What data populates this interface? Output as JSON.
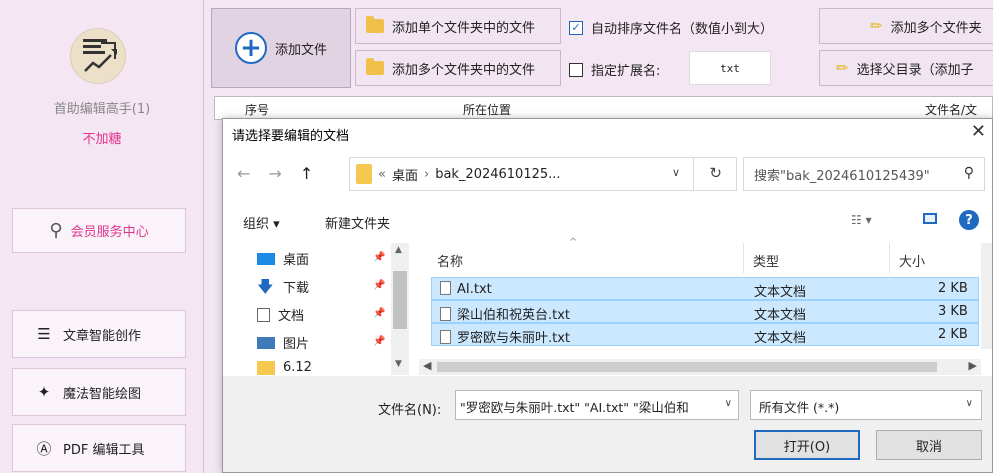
{
  "sidebar": {
    "user_name": "首助编辑高手(1)",
    "user_status": "不加糖",
    "member_center": "会员服务中心",
    "nav": [
      {
        "label": "文章智能创作",
        "icon": "menu-lines-icon"
      },
      {
        "label": "魔法智能绘图",
        "icon": "magic-wand-icon"
      },
      {
        "label": "PDF 编辑工具",
        "icon": "pdf-icon"
      }
    ]
  },
  "toolbar": {
    "add_file": "添加文件",
    "add_single_folder": "添加单个文件夹中的文件",
    "add_multi_folder": "添加多个文件夹中的文件",
    "auto_sort": "自动排序文件名（数值小到大）",
    "auto_sort_checked": true,
    "specify_ext": "指定扩展名:",
    "specify_ext_checked": false,
    "ext_value": "txt",
    "add_multi_files": "添加多个文件夹",
    "choose_parent": "选择父目录（添加子"
  },
  "list_header": {
    "col_index": "序号",
    "col_location": "所在位置",
    "col_filename": "文件名/文"
  },
  "dialog": {
    "title": "请选择要编辑的文档",
    "breadcrumb": {
      "prefix": "«",
      "parent": "桌面",
      "current": "bak_2024610125..."
    },
    "search_placeholder": "搜索\"bak_2024610125439\"",
    "organize": "组织 ▾",
    "new_folder": "新建文件夹",
    "nav_pane": [
      {
        "label": "桌面",
        "icon": "desktop-icon"
      },
      {
        "label": "下载",
        "icon": "download-icon"
      },
      {
        "label": "文档",
        "icon": "document-icon"
      },
      {
        "label": "图片",
        "icon": "picture-icon"
      },
      {
        "label": "6.12",
        "icon": "folder-icon"
      }
    ],
    "columns": {
      "name": "名称",
      "type": "类型",
      "size": "大小"
    },
    "files": [
      {
        "name": "AI.txt",
        "type": "文本文档",
        "size": "2 KB"
      },
      {
        "name": "梁山伯和祝英台.txt",
        "type": "文本文档",
        "size": "3 KB"
      },
      {
        "name": "罗密欧与朱丽叶.txt",
        "type": "文本文档",
        "size": "2 KB"
      }
    ],
    "filename_label": "文件名(N):",
    "filename_value": "\"罗密欧与朱丽叶.txt\" \"AI.txt\" \"梁山伯和",
    "filetype_value": "所有文件 (*.*)",
    "open_label": "打开(O)",
    "cancel_label": "取消"
  },
  "colors": {
    "accent": "#1e6ac0",
    "pink": "#e0348c",
    "selection": "#cce8ff"
  }
}
